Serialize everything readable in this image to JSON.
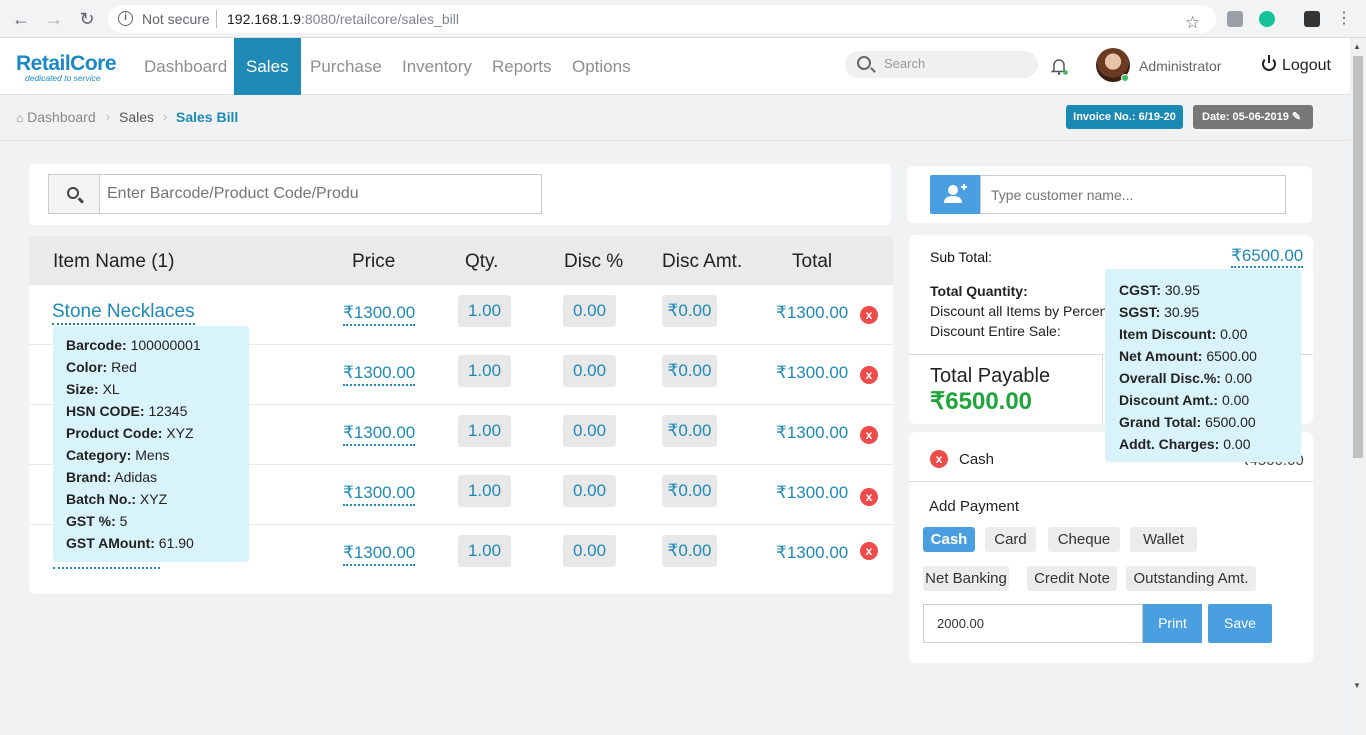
{
  "browser": {
    "not_secure": "Not secure",
    "url_host": "192.168.1.9",
    "url_rest": ":8080/retailcore/sales_bill"
  },
  "header": {
    "logo": "RetailCore",
    "logo_tagline": "dedicated to service",
    "nav": [
      "Dashboard",
      "Sales",
      "Purchase",
      "Inventory",
      "Reports",
      "Options"
    ],
    "active_nav": "Sales",
    "search_placeholder": "Search",
    "user": "Administrator",
    "logout": "Logout"
  },
  "breadcrumb": {
    "items": [
      "Dashboard",
      "Sales",
      "Sales Bill"
    ],
    "invoice_no": "Invoice No.: 6/19-20",
    "date": "Date: 05-06-2019"
  },
  "scan": {
    "placeholder": "Enter Barcode/Product Code/Produ"
  },
  "items_table": {
    "headers": [
      "Item Name (1)",
      "Price",
      "Qty.",
      "Disc %",
      "Disc Amt.",
      "Total"
    ],
    "rows": [
      {
        "name": "Stone Necklaces",
        "price": "₹1300.00",
        "qty": "1.00",
        "disc_pct": "0.00",
        "disc_amt": "₹0.00",
        "total": "₹1300.00"
      },
      {
        "name": "",
        "price": "₹1300.00",
        "qty": "1.00",
        "disc_pct": "0.00",
        "disc_amt": "₹0.00",
        "total": "₹1300.00"
      },
      {
        "name": "",
        "price": "₹1300.00",
        "qty": "1.00",
        "disc_pct": "0.00",
        "disc_amt": "₹0.00",
        "total": "₹1300.00"
      },
      {
        "name": "",
        "price": "₹1300.00",
        "qty": "1.00",
        "disc_pct": "0.00",
        "disc_amt": "₹0.00",
        "total": "₹1300.00"
      },
      {
        "name": "",
        "price": "₹1300.00",
        "qty": "1.00",
        "disc_pct": "0.00",
        "disc_amt": "₹0.00",
        "total": "₹1300.00"
      }
    ],
    "delete_glyph": "x"
  },
  "item_tooltip": [
    {
      "k": "Barcode:",
      "v": "100000001"
    },
    {
      "k": "Color:",
      "v": "Red"
    },
    {
      "k": "Size:",
      "v": "XL"
    },
    {
      "k": "HSN CODE:",
      "v": "12345"
    },
    {
      "k": "Product Code:",
      "v": "XYZ"
    },
    {
      "k": "Category:",
      "v": "Mens"
    },
    {
      "k": "Brand:",
      "v": "Adidas"
    },
    {
      "k": "Batch No.:",
      "v": "XYZ"
    },
    {
      "k": "GST %:",
      "v": "5"
    },
    {
      "k": "GST AMount:",
      "v": "61.90"
    }
  ],
  "customer": {
    "placeholder": "Type customer name..."
  },
  "summary": {
    "sub_total_label": "Sub Total:",
    "sub_total": "₹6500.00",
    "total_qty_label": "Total Quantity:",
    "disc_items_label": "Discount all Items by Percen",
    "disc_sale_label": "Discount Entire Sale:",
    "total_payable_label": "Total Payable",
    "total_payable": "₹6500.00"
  },
  "summary_tooltip": [
    {
      "k": "CGST:",
      "v": "30.95"
    },
    {
      "k": "SGST:",
      "v": "30.95"
    },
    {
      "k": "Item Discount:",
      "v": "0.00"
    },
    {
      "k": "Net Amount:",
      "v": "6500.00"
    },
    {
      "k": "Overall Disc.%:",
      "v": "0.00"
    },
    {
      "k": "Discount Amt.:",
      "v": "0.00"
    },
    {
      "k": "Grand Total:",
      "v": "6500.00"
    },
    {
      "k": "Addt. Charges:",
      "v": "0.00"
    }
  ],
  "payment": {
    "line_label": "Cash",
    "line_amount": "₹4500.00",
    "add_payment": "Add Payment",
    "methods": [
      "Cash",
      "Card",
      "Cheque",
      "Wallet",
      "Net Banking",
      "Credit Note",
      "Outstanding Amt."
    ],
    "active_method": "Cash",
    "amount_value": "2000.00",
    "print": "Print",
    "save": "Save"
  },
  "colors": {
    "brand": "#1f8ab6",
    "button": "#4a9fe0",
    "danger": "#ee4b4b",
    "success": "#20a53a"
  }
}
